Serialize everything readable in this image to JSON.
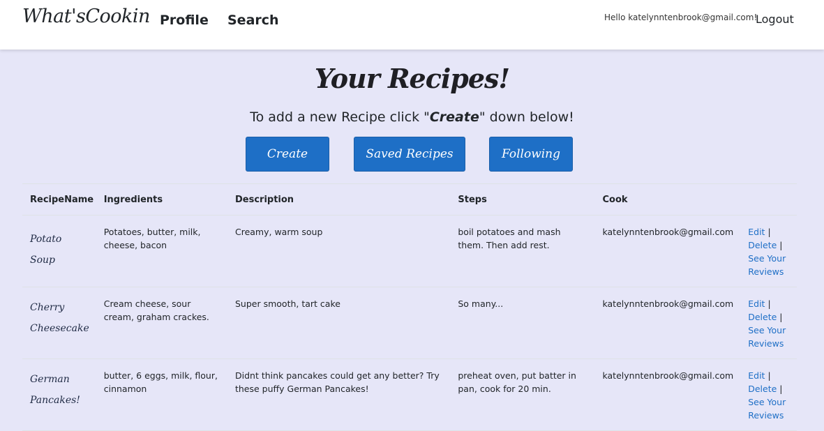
{
  "nav": {
    "brand": "What'sCookin",
    "profile": "Profile",
    "search": "Search",
    "hello": "Hello katelynntenbrook@gmail.com!",
    "logout": "Logout"
  },
  "main": {
    "heading": "Your Recipes!",
    "sub_before": "To add a new Recipe click \"",
    "sub_em": "Create",
    "sub_after": "\" down below!",
    "buttons": {
      "create": "Create",
      "saved": "Saved Recipes",
      "following": "Following"
    }
  },
  "table": {
    "headers": [
      "RecipeName",
      "Ingredients",
      "Description",
      "Steps",
      "Cook"
    ],
    "actions": {
      "edit": "Edit",
      "delete": "Delete",
      "see_reviews": "See Your Reviews",
      "sep": "|"
    },
    "rows": [
      {
        "name": "Potato Soup",
        "ingredients": "Potatoes, butter, milk, cheese, bacon",
        "description": "Creamy, warm soup",
        "steps": "boil potatoes and mash them. Then add rest.",
        "cook": "katelynntenbrook@gmail.com"
      },
      {
        "name": "Cherry Cheesecake",
        "ingredients": "Cream cheese, sour cream, graham crackes.",
        "description": "Super smooth, tart cake",
        "steps": "So many...",
        "cook": "katelynntenbrook@gmail.com"
      },
      {
        "name": "German Pancakes!",
        "ingredients": "butter, 6 eggs, milk, flour, cinnamon",
        "description": "Didnt think pancakes could get any better? Try these puffy German Pancakes!",
        "steps": "preheat oven, put batter in pan, cook for 20 min.",
        "cook": "katelynntenbrook@gmail.com"
      }
    ]
  },
  "colors": {
    "background": "#e6e6f8",
    "button": "#1e6fc6",
    "link": "#1e6fc6"
  }
}
